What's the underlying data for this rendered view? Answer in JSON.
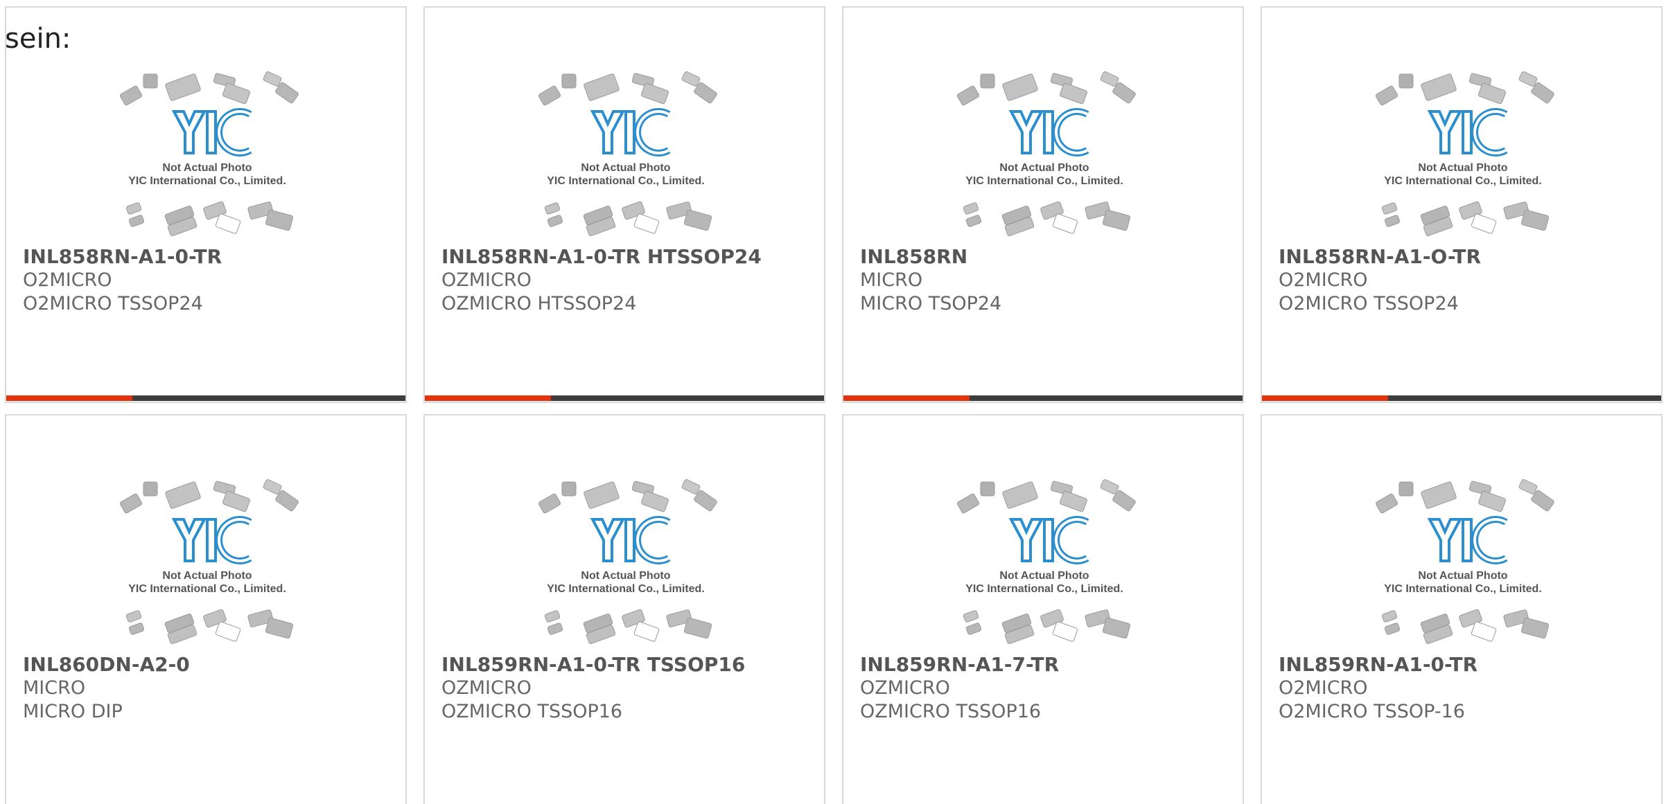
{
  "intro_text": "sein:",
  "placeholder": {
    "caption_line1": "Not Actual Photo",
    "caption_line2": "YIC International Co., Limited.",
    "logo_text": "YIC"
  },
  "colors": {
    "accent": "#e2330c",
    "bar": "#3d3d3d",
    "logo_blue": "#2b8fcf"
  },
  "products": [
    {
      "part": "INL858RN-A1-0-TR",
      "maker": "O2MICRO",
      "package": "O2MICRO TSSOP24"
    },
    {
      "part": "INL858RN-A1-0-TR HTSSOP24",
      "maker": "OZMICRO",
      "package": "OZMICRO HTSSOP24"
    },
    {
      "part": "INL858RN",
      "maker": "MICRO",
      "package": "MICRO TSOP24"
    },
    {
      "part": "INL858RN-A1-O-TR",
      "maker": "O2MICRO",
      "package": "O2MICRO TSSOP24"
    },
    {
      "part": "INL860DN-A2-0",
      "maker": "MICRO",
      "package": "MICRO DIP"
    },
    {
      "part": "INL859RN-A1-0-TR TSSOP16",
      "maker": "OZMICRO",
      "package": "OZMICRO TSSOP16"
    },
    {
      "part": "INL859RN-A1-7-TR",
      "maker": "OZMICRO",
      "package": "OZMICRO TSSOP16"
    },
    {
      "part": "INL859RN-A1-0-TR",
      "maker": "O2MICRO",
      "package": "O2MICRO TSSOP-16"
    }
  ]
}
